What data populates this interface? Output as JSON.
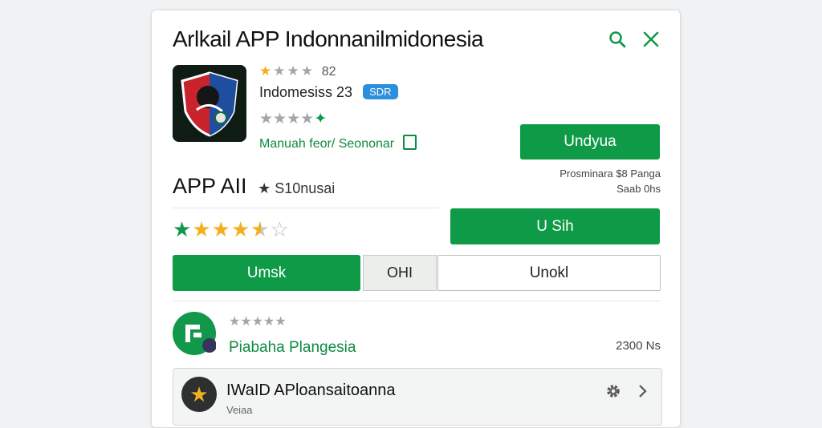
{
  "header": {
    "title": "Arlkail  APP Indonnanilmidonesia",
    "search_icon": "search-icon",
    "close_icon": "close-icon"
  },
  "app": {
    "rating_count": "82",
    "rating_stars": 1,
    "name": "Indomesiss 23",
    "badge": "SDR",
    "second_rating_stars": 4,
    "subtitle": "Manuah feor/ Seononar",
    "install_label": "Undyua",
    "meta_line1": "Prosminara  $8 Panga",
    "meta_line2": "Saab 0hs"
  },
  "section": {
    "heading": "APP AII",
    "heading_suffix": "S10nusai",
    "rating_stars": 4.5,
    "action_label": "U Sih"
  },
  "tabs": {
    "primary": "Umsk",
    "middle": "OHI",
    "right": "Unokl"
  },
  "list_item": {
    "stars_filled": 0,
    "title": "Piabaha Plangesia",
    "size": "2300 Ns"
  },
  "bottom_item": {
    "title": "IWaID APloansaitoanna",
    "subtitle": "Veiaa"
  },
  "colors": {
    "accent_green": "#0f9a48",
    "star_gold": "#f2b01e",
    "badge_blue": "#2b8fdc"
  }
}
